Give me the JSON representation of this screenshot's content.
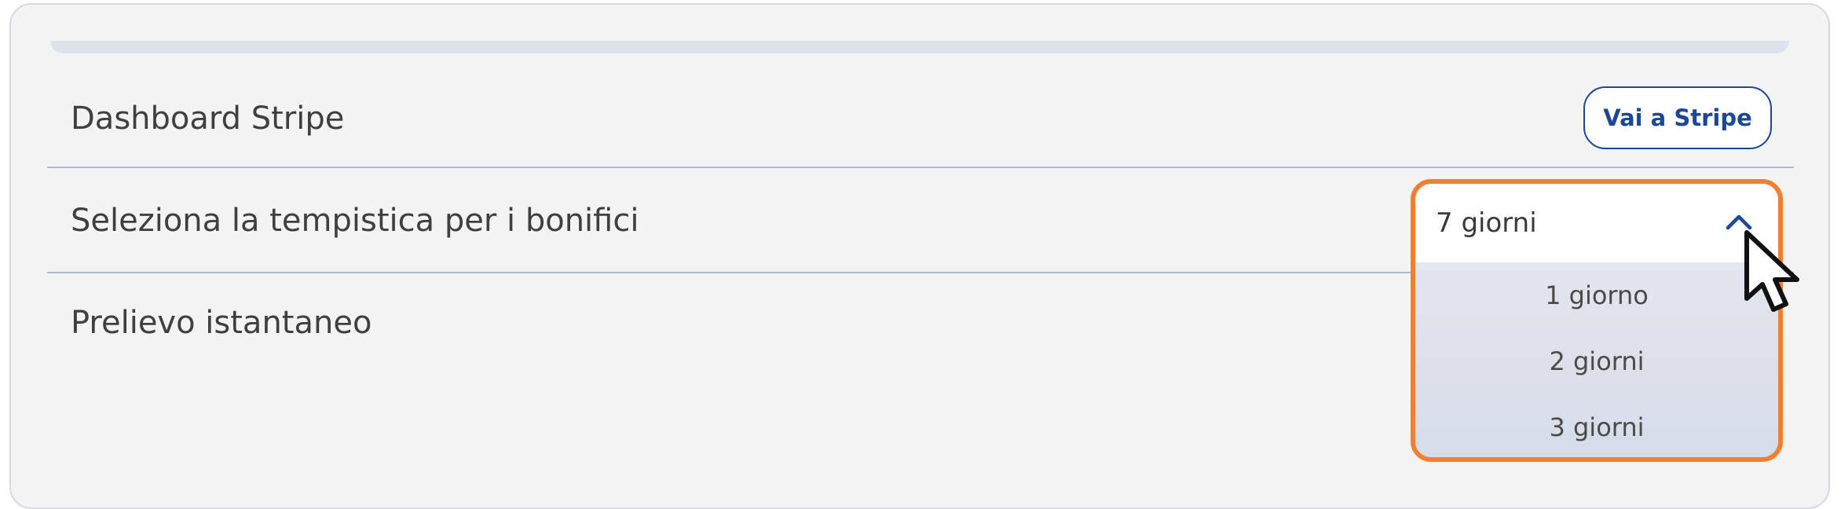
{
  "settings": {
    "stripe_dashboard": {
      "label": "Dashboard Stripe",
      "button_label": "Vai a Stripe"
    },
    "transfer_timing": {
      "label": "Seleziona la tempistica per i bonifici",
      "selected_value": "7 giorni",
      "options": [
        "1 giorno",
        "2 giorni",
        "3 giorni"
      ]
    },
    "instant_payout": {
      "label": "Prelievo istantaneo"
    }
  },
  "icons": {
    "chevron": "chevron-up-icon",
    "cursor": "mouse-pointer-icon"
  },
  "colors": {
    "accent": "#1a4796",
    "highlight_border": "#f08030",
    "divider": "#a9bbd9"
  }
}
